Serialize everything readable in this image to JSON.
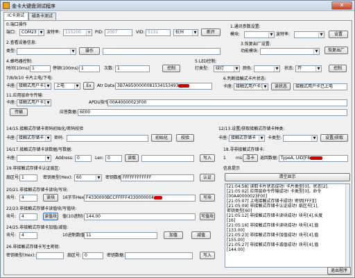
{
  "window": {
    "title": "金卡大键盘测试程序",
    "close": "✕"
  },
  "tabs": [
    {
      "label": "IC卡测试"
    },
    {
      "label": "磁条卡测试"
    }
  ],
  "port": {
    "title": "0.端口操作",
    "port_label": "端口:",
    "port_value": "COM23",
    "baud_label": "波特率:",
    "baud_value": "115200",
    "pid_label": "PID:",
    "pid_value": "2007",
    "vid_label": "VID:",
    "vid_value": "5131",
    "city_value": "杭州",
    "open_btn": "断开"
  },
  "comm": {
    "title": "1.通讯参数设置:",
    "module_label": "模块:",
    "baud_label": "波特率:",
    "set_btn": "设置"
  },
  "version": {
    "title": "2.查看设备信息:",
    "type_label": "类型:",
    "btn": "操作"
  },
  "restore": {
    "title": "3.恢复出厂设置:",
    "func_label": "功能模块:",
    "btn": "恢复出厂"
  },
  "buzzer": {
    "title": "4.蜂鸣器控制:",
    "time_label": "时间(10ms):",
    "time_value": "1",
    "interval_label": "停顿(100ms):",
    "interval_value": "1",
    "count_label": "次数:",
    "count_value": "1",
    "btn": "控制"
  },
  "led": {
    "title": "5.LED控制:",
    "type_label": "灯类型:",
    "type_value": "绿灯",
    "color_label": "颜色:",
    "state_label": "状态:",
    "state_value": "开",
    "btn": "控制"
  },
  "power": {
    "title": "7/8/9/10 卡片上电/下电:",
    "card_label": "卡座:",
    "card_value": "接触式用户卡1",
    "op_value": "上电",
    "btn": "Ex",
    "atr_label": "Atr Data:",
    "atr_value": "3B7A9500000081534153493"
  },
  "status": {
    "title": "6.判断接触式卡片状态:",
    "card_label": "卡座:",
    "card_value": "接触式用户卡1",
    "btn": "读状态",
    "result": "接触式用户卡已上电"
  },
  "apdu": {
    "title": "11.应用层命令传输:",
    "card_label": "卡座:",
    "card_value": "接触式用户卡1",
    "cmd_label": "APDU指令:",
    "cmd_value": "00A40000023F00",
    "btn": "传输",
    "resp_label": "应答数据:",
    "resp_value": "6E00"
  },
  "mem_verify": {
    "title": "14/15.接触式存储卡密码初始化/密码校验",
    "card_label": "卡座:",
    "card_value": "接触式存储卡",
    "pwd_label": "密码:",
    "init_btn": "初始化",
    "verify_btn": "校验"
  },
  "mem_select": {
    "title": "12/13.设置/获取接触式存储卡种类:",
    "card_label": "卡座:",
    "card_value": "接触式存储卡",
    "type_label": "卡类型:",
    "btn": "设置/获取"
  },
  "mem_rw": {
    "title": "16/17.接触式存储卡读数据/写数据:",
    "card_label": "卡座:",
    "addr_label": "Address:",
    "addr_value": "0",
    "len_label": "Len:",
    "len_value": "0",
    "read_btn": "读取",
    "write_btn": "写入"
  },
  "rfsearch": {
    "title": "18.寻非接触式存储卡:",
    "count_value": "1",
    "unit": "ms",
    "btn": "寻卡",
    "resp_label": "返回数据:",
    "resp_value": "TypeA, UID[F8"
  },
  "auth": {
    "title": "19.非接触式存储卡认证扇区:",
    "sector_label": "扇区号:",
    "sector_value": "1",
    "type_label": "密钥类型(Hex):",
    "type_value": "60",
    "key_label": "密钥数据:",
    "key_value": "FFFFFFFFFFFF",
    "btn": "认证"
  },
  "log": {
    "title": "信息提示",
    "clear_btn": "清空显示",
    "lines": [
      "[21:04:58] 读取卡片状态成功! 卡片类型[0]，状态[2].",
      "[21:05:02] 应用层命令传输成功! 卡类型[0]，命令",
      "[00A40000023F00]",
      "[21:05:07] 上电接触式存储卡成功! 密钥[FFF][]",
      "[21:05:09] 非接触式存储卡认证成功! 扇区号[1],",
      "密钥类型[60]",
      "[21:05:12] 非接触式存储卡读块成功! 块号[4],长度",
      "[16]",
      "[21:05:16] 非接触式存储卡读块成功! 块号[4],值",
      "[133.00]",
      "[21:05:23] 非接触式存储卡加值成功! 块号[4],值",
      "[155.00]",
      "[21:05:27] 非接触式存储卡减值成功! 块号[4],值",
      "[144.00]"
    ]
  },
  "block_rw": {
    "title": "20/21.非接触式存储卡读块/写块:",
    "block_label": "块号:",
    "block_value": "4",
    "read_btn": "读块",
    "hex_label": "16字节Hex:",
    "hex_value": "F4330000BCCFFFFF4330000004",
    "write_btn": "写块"
  },
  "wallet": {
    "title": "22/23.非接触式存储卡读值块/写值块:",
    "block_label": "块号:",
    "block_value": "4",
    "read_btn": "读值块",
    "dec_label": "值(10进制):",
    "dec_value": "144.00",
    "write_btn": "写值块"
  },
  "incdec": {
    "title": "24/25.非接触式存储卡加值/减值:",
    "block_label": "块号:",
    "block_value": "4",
    "dec_label": "10进制数值:",
    "dec_value": "11",
    "inc_btn": "加值",
    "dec_btn": "减值"
  },
  "keyw": {
    "title": "26.非接触式存储卡写主密钥:",
    "type_label": "密钥类型(Hex):",
    "sector_label": "扇区号:",
    "sector_value": "0",
    "key_label": "密钥数据:",
    "btn": "写入"
  },
  "footer": {
    "exit_btn": "退出程序"
  },
  "colors": {
    "redact": "#d40000",
    "titlebar": "#c8d6e6"
  }
}
